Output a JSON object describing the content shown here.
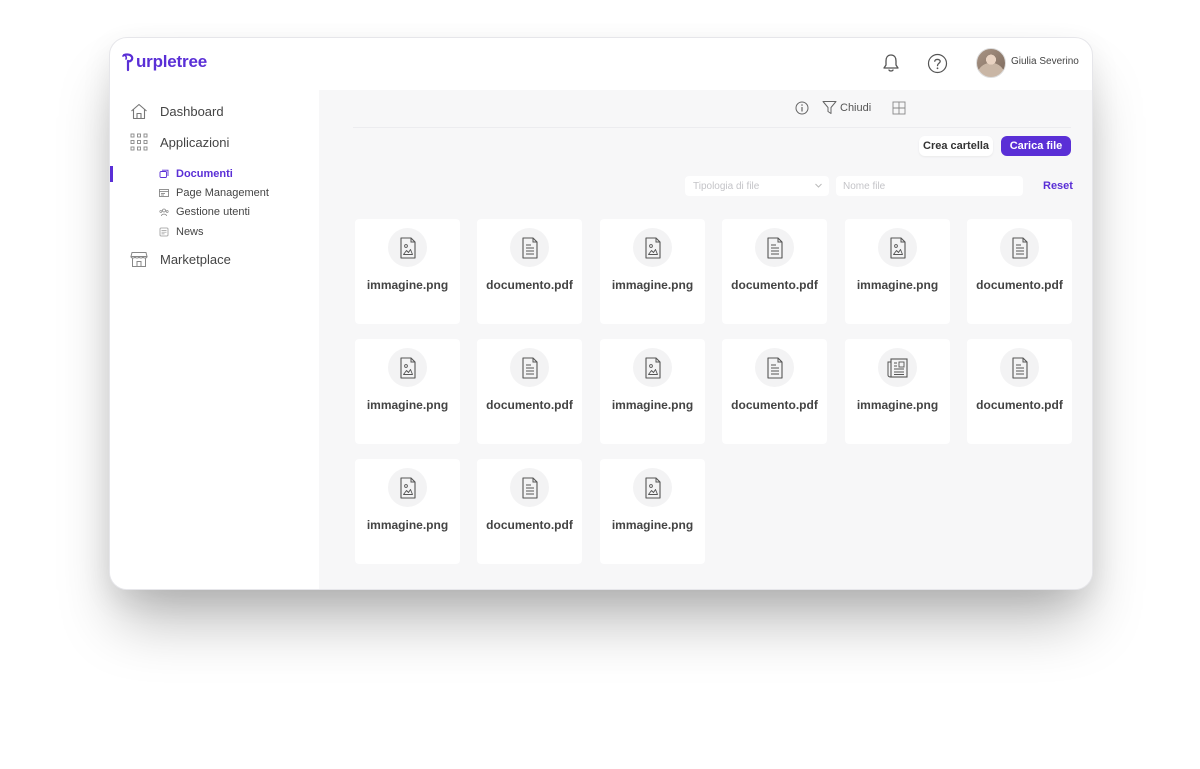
{
  "header": {
    "logo_text": "urpletree",
    "user_name": "Giulia Severino",
    "icons": [
      "bell-icon",
      "help-icon"
    ]
  },
  "sidebar": {
    "main_items": [
      {
        "label": "Dashboard",
        "icon": "home-icon"
      },
      {
        "label": "Applicazioni",
        "icon": "apps-grid-icon"
      },
      {
        "label": "Marketplace",
        "icon": "store-icon"
      }
    ],
    "sub_items": [
      {
        "label": "Documenti",
        "icon": "documents-icon",
        "active": true
      },
      {
        "label": "Page Management",
        "icon": "page-icon",
        "active": false
      },
      {
        "label": "Gestione utenti",
        "icon": "users-icon",
        "active": false
      },
      {
        "label": "News",
        "icon": "news-icon",
        "active": false
      }
    ]
  },
  "toolbar": {
    "close_filter_label": "Chiudi",
    "create_folder_label": "Crea cartella",
    "upload_label": "Carica file",
    "icons": [
      "info-icon",
      "filter-icon",
      "grid-view-icon"
    ]
  },
  "filters": {
    "file_type_placeholder": "Tipologia di file",
    "file_name_placeholder": "Nome file",
    "reset_label": "Reset"
  },
  "files": [
    {
      "name": "immagine.png",
      "icon": "image-file-icon"
    },
    {
      "name": "documento.pdf",
      "icon": "document-file-icon"
    },
    {
      "name": "immagine.png",
      "icon": "image-file-icon"
    },
    {
      "name": "documento.pdf",
      "icon": "document-file-icon"
    },
    {
      "name": "immagine.png",
      "icon": "image-file-icon"
    },
    {
      "name": "documento.pdf",
      "icon": "document-file-icon"
    },
    {
      "name": "immagine.png",
      "icon": "image-file-icon"
    },
    {
      "name": "documento.pdf",
      "icon": "document-file-icon"
    },
    {
      "name": "immagine.png",
      "icon": "image-file-icon"
    },
    {
      "name": "documento.pdf",
      "icon": "document-file-icon"
    },
    {
      "name": "immagine.png",
      "icon": "newspaper-file-icon"
    },
    {
      "name": "documento.pdf",
      "icon": "document-file-icon"
    },
    {
      "name": "immagine.png",
      "icon": "image-file-icon"
    },
    {
      "name": "documento.pdf",
      "icon": "document-file-icon"
    },
    {
      "name": "immagine.png",
      "icon": "image-file-icon"
    }
  ],
  "colors": {
    "accent": "#5a2fd6",
    "main_bg": "#f7f7f8"
  }
}
